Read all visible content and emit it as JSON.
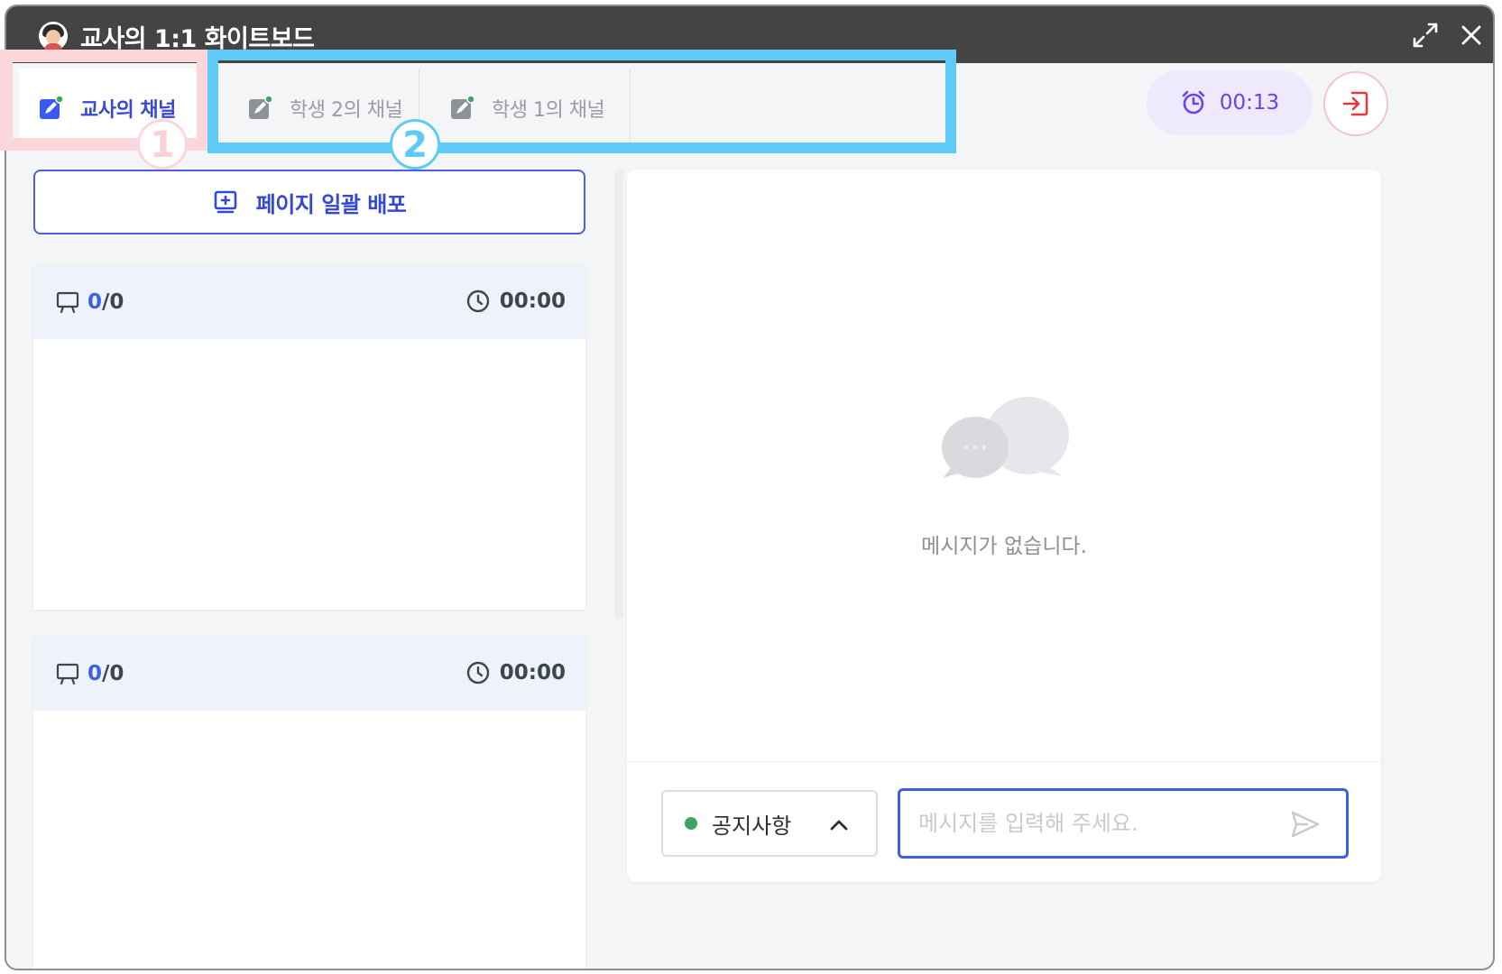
{
  "window": {
    "title": "교사의 1:1 화이트보드"
  },
  "tabs": [
    {
      "label": "교사의 채널",
      "active": true
    },
    {
      "label": "학생 2의 채널",
      "active": false
    },
    {
      "label": "학생 1의 채널",
      "active": false
    }
  ],
  "annotations": {
    "badge_1": "1",
    "badge_2": "2"
  },
  "timer": {
    "value": "00:13"
  },
  "left_panel": {
    "bulk_distribute_label": "페이지 일괄 배포",
    "pages": [
      {
        "slide_current": "0",
        "slide_total": "/0",
        "duration": "00:00"
      },
      {
        "slide_current": "0",
        "slide_total": "/0",
        "duration": "00:00"
      }
    ]
  },
  "chat": {
    "empty_message": "메시지가 없습니다.",
    "notice_select": {
      "selected": "공지사항"
    },
    "input": {
      "value": "",
      "placeholder": "메시지를 입력해 주세요."
    }
  },
  "colors": {
    "accent": "#3a48d9",
    "timer": "#6c43e6",
    "exit": "#e0393e",
    "notice_dot": "#3da461",
    "annotation_pink": "#fbd7dc",
    "annotation_blue": "#5ecbf6"
  },
  "icons": {
    "window": [
      "avatar",
      "expand-icon",
      "close-icon"
    ],
    "tabs": "pencil-edit-icon",
    "timer": "alarm-clock-icon",
    "exit": "exit-icon",
    "bulk": "add-page-icon",
    "card": [
      "presentation-icon",
      "clock-icon"
    ],
    "chat": [
      "chat-bubbles-icon",
      "chevron-up-icon",
      "send-icon"
    ]
  }
}
